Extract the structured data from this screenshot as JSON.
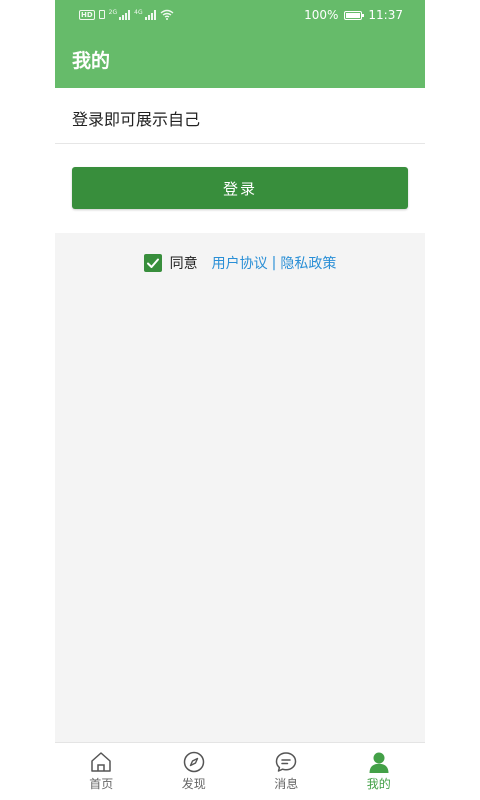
{
  "status_bar": {
    "hd_label": "HD",
    "net_tag_1": "2G",
    "net_tag_2": "4G",
    "battery_text": "100%",
    "time": "11:37"
  },
  "header": {
    "title": "我的"
  },
  "profile": {
    "prompt": "登录即可展示自己"
  },
  "login": {
    "button_label": "登录"
  },
  "agreement": {
    "checked": true,
    "agree_label": "同意",
    "user_agreement": "用户协议",
    "separator": "|",
    "privacy_policy": "隐私政策"
  },
  "bottom_nav": {
    "items": [
      {
        "label": "首页",
        "icon": "home-icon"
      },
      {
        "label": "发现",
        "icon": "compass-icon"
      },
      {
        "label": "消息",
        "icon": "message-icon"
      },
      {
        "label": "我的",
        "icon": "person-icon"
      }
    ],
    "active_index": 3
  },
  "colors": {
    "header_green": "#66bb6a",
    "button_green": "#388e3c",
    "link_blue": "#2a8fd6",
    "nav_active": "#43a047"
  }
}
